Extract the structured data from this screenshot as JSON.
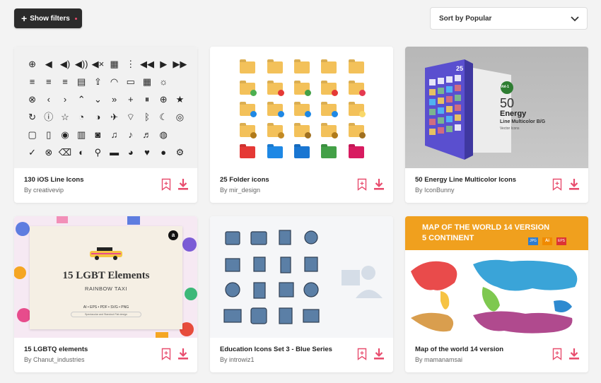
{
  "toolbar": {
    "filters_label": "Show filters",
    "sort_label": "Sort by Popular"
  },
  "cards": [
    {
      "title": "130 iOS Line Icons",
      "author": "By creativevip"
    },
    {
      "title": "25 Folder icons",
      "author": "By mir_design"
    },
    {
      "title": "50 Energy Line Multicolor Icons",
      "author": "By IconBunny"
    },
    {
      "title": "15 LGBTQ elements",
      "author": "By Chanut_industries"
    },
    {
      "title": "Education Icons Set 3 - Blue Series",
      "author": "By introwiz1"
    },
    {
      "title": "Map of the world 14 version",
      "author": "By mamanamsai"
    }
  ],
  "thumbs": {
    "energy": {
      "badge": "Vol-1",
      "big": "50",
      "line1": "Energy",
      "line2": "Line Multicolor B/G",
      "line3": "Vector Icons",
      "corner": "25"
    },
    "lgbt": {
      "title": "15 LGBT Elements",
      "subtitle": "RAINBOW TAXI",
      "formats": "AI  •  EPS  •  PDF  •  SVG  •  PNG",
      "tagline": "Spectacular and Standout Flat design"
    },
    "map": {
      "line1": "MAP OF THE WORLD 14 VERSION",
      "line2": "5 CONTINENT",
      "f1": "JPG",
      "f2": "Ai",
      "f3": "EPS"
    }
  },
  "colors": {
    "accent": "#e84d6e",
    "dark_button": "#2b2b2b"
  },
  "icons": {
    "bookmark": "bookmark-icon",
    "download": "download-icon",
    "sort": "chevron-down-icon",
    "filters": "plus-icon"
  }
}
